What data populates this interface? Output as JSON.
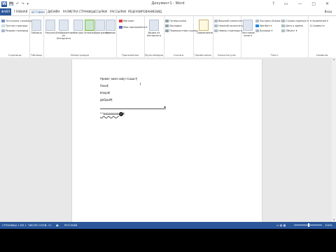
{
  "titlebar": {
    "app_icon": "W",
    "qat": "💾 ↶ ↷ ▾",
    "title": "Документ1 - Word",
    "window_buttons": "? ▭ — ▢ ✕"
  },
  "tabs": {
    "file": "ФАЙЛ",
    "items": [
      "ГЛАВНАЯ",
      "ВСТАВКА",
      "ДИЗАЙН",
      "РАЗМЕТКА СТРАНИЦЫ",
      "ССЫЛКИ",
      "РАССЫЛКИ",
      "РЕЦЕНЗИРОВАНИЕ",
      "ВИД"
    ],
    "user": "Вход"
  },
  "ribbon": {
    "pages_group": {
      "items": [
        "Титульная страница ▾",
        "Пустая страница",
        "Разрыв страницы"
      ],
      "label": "Страницы"
    },
    "tables_group": {
      "button": "Таблица",
      "label": "Таблицы"
    },
    "illustrations_group": {
      "buttons": [
        "Рисунки",
        "Изображения из Интернета",
        "Фигуры",
        "SmartArt",
        "Диаграмма",
        "Снимок"
      ],
      "label": "Иллюстрации"
    },
    "apps_group": {
      "items": [
        "Магазин",
        "Мои приложения ▾"
      ],
      "label": "Приложения"
    },
    "media_group": {
      "button": "Видео из Интернета",
      "label": "Мультимедиа"
    },
    "links_group": {
      "items": [
        "Гиперссылка",
        "Закладка",
        "Перекрестная ссылка"
      ],
      "label": "Ссылки"
    },
    "comments_group": {
      "button": "Примечание",
      "label": "Примечания"
    },
    "headerfooter_group": {
      "items": [
        "Верхний колонтитул ▾",
        "Нижний колонтитул ▾",
        "Номер страницы ▾"
      ],
      "label": "Колонтитулы"
    },
    "text_group": {
      "button": "Текстовое поле ▾",
      "items": [
        "Экспресс-блоки ▾",
        "WordArt ▾",
        "Буквица ▾"
      ],
      "items2": [
        "Строка подписи ▾",
        "Дата и время",
        "Объект ▾"
      ],
      "label": "Текст"
    },
    "symbols_group": {
      "items": [
        "π Уравнение ▾",
        "Ω Символ ▾"
      ],
      "label": "Символы"
    }
  },
  "document": {
    "lines": [
      "Привет, меня зовут Саша.",
      "Пока",
      "Вчера",
      "Добрый"
    ],
    "pilcrow": "¶",
    "autocorrect_line": "\"\"\"&&&&&&&&",
    "autocorrect_icon": "✓"
  },
  "statusbar": {
    "page": "СТРАНИЦА 1 ИЗ 1",
    "words": "ЧИСЛО СЛОВ: 11",
    "language": "РУССКИЙ",
    "zoom": "100%"
  },
  "colors": {
    "accent": "#2b579a",
    "statusbar": "#2b579a"
  }
}
